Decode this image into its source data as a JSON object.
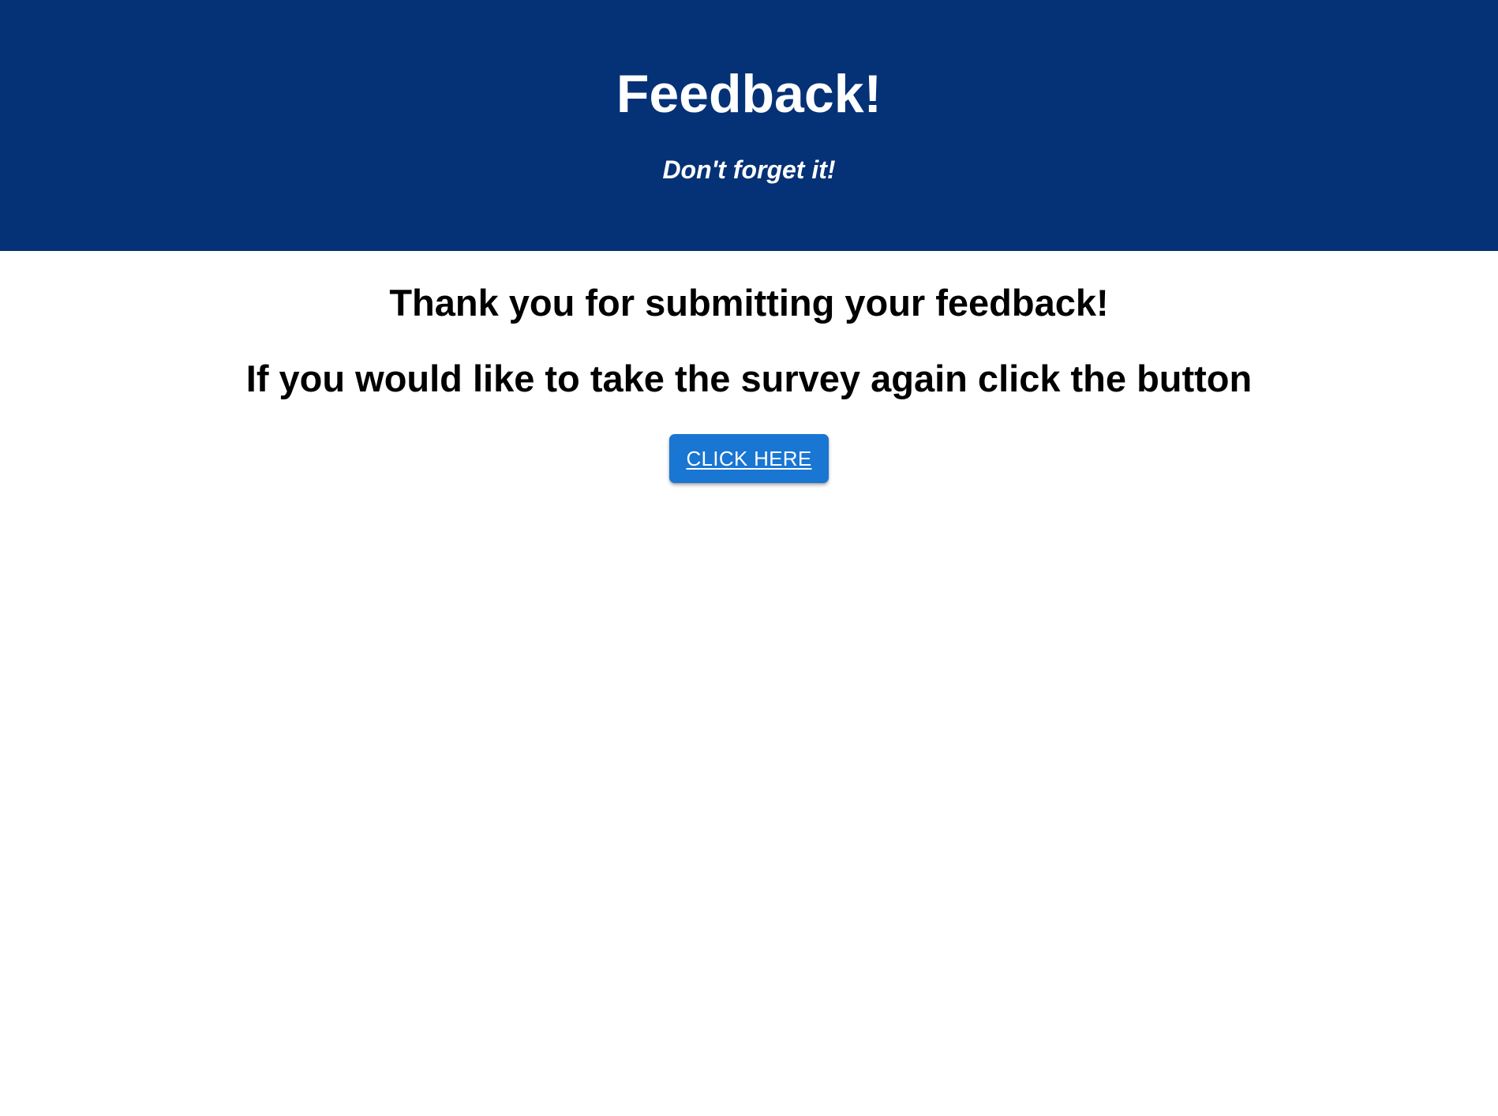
{
  "header": {
    "title": "Feedback!",
    "subtitle": "Don't forget it!",
    "background_color": "#053176"
  },
  "main": {
    "thank_you": "Thank you for submitting your feedback!",
    "retake_prompt": "If you would like to take the survey again click the button",
    "button_label": "CLICK HERE",
    "button_color": "#1976d2"
  }
}
